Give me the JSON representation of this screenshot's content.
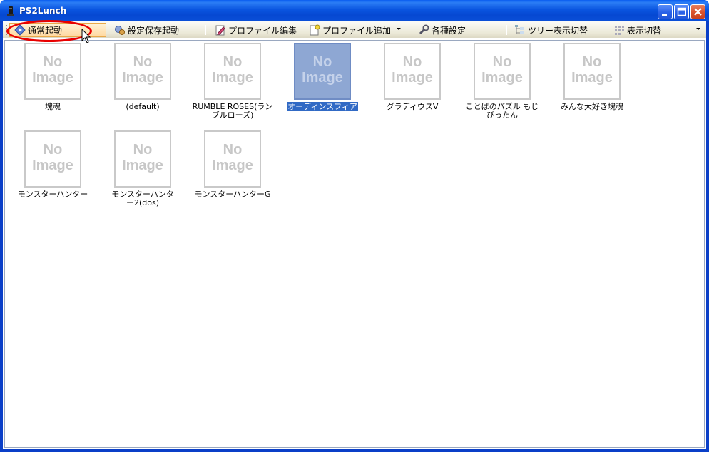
{
  "window": {
    "title": "PS2Lunch"
  },
  "toolbar": {
    "items": [
      {
        "label": "通常起動",
        "icon": "launch-icon"
      },
      {
        "label": "設定保存起動",
        "icon": "save-launch-icon"
      },
      {
        "label": "プロファイル編集",
        "icon": "edit-profile-icon"
      },
      {
        "label": "プロファイル追加",
        "icon": "add-profile-icon"
      },
      {
        "label": "各種設定",
        "icon": "wrench-icon"
      },
      {
        "label": "ツリー表示切替",
        "icon": "tree-icon"
      },
      {
        "label": "表示切替",
        "icon": "view-icon"
      }
    ]
  },
  "thumbnail_placeholder": {
    "line1": "No",
    "line2": "Image"
  },
  "profiles": [
    {
      "name": "塊魂"
    },
    {
      "name": "(default)"
    },
    {
      "name": "RUMBLE ROSES(ランブルローズ)"
    },
    {
      "name": "オーディンスフィア",
      "selected": true
    },
    {
      "name": "グラディウスV"
    },
    {
      "name": "ことばのパズル もじぴったん"
    },
    {
      "name": "みんな大好き塊魂"
    },
    {
      "name": "モンスターハンター"
    },
    {
      "name": "モンスターハンター2(dos)"
    },
    {
      "name": "モンスターハンターG"
    }
  ],
  "colors": {
    "title_bar": "#0a55e0",
    "selection": "#316ac5",
    "annotation": "#e80000"
  }
}
